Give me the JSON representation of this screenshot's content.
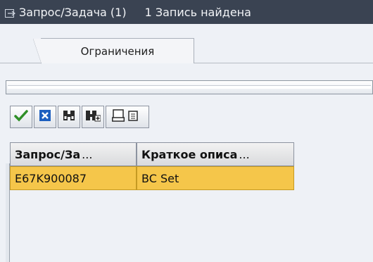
{
  "window": {
    "title": "Запрос/Задача (1)",
    "status": "1 Запись найдена"
  },
  "tabs": [
    {
      "label": "Ограничения"
    }
  ],
  "toolbar": {
    "buttons": [
      {
        "name": "confirm",
        "icon": "checkmark-icon",
        "color": "#2f8f27"
      },
      {
        "name": "cancel",
        "icon": "cancel-icon",
        "color": "#1d5fbf"
      },
      {
        "name": "find",
        "icon": "binoculars-icon"
      },
      {
        "name": "find-next",
        "icon": "binoculars-plus-icon"
      },
      {
        "name": "print",
        "icon": "print-icon"
      }
    ]
  },
  "table": {
    "headers": [
      "Запрос/За",
      "Краткое описа"
    ],
    "rows": [
      [
        "E67K900087",
        "BC Set"
      ]
    ]
  },
  "colors": {
    "titlebar_bg": "#3a4352",
    "selected_row": "#f5c64a",
    "background": "#eef1f6"
  }
}
